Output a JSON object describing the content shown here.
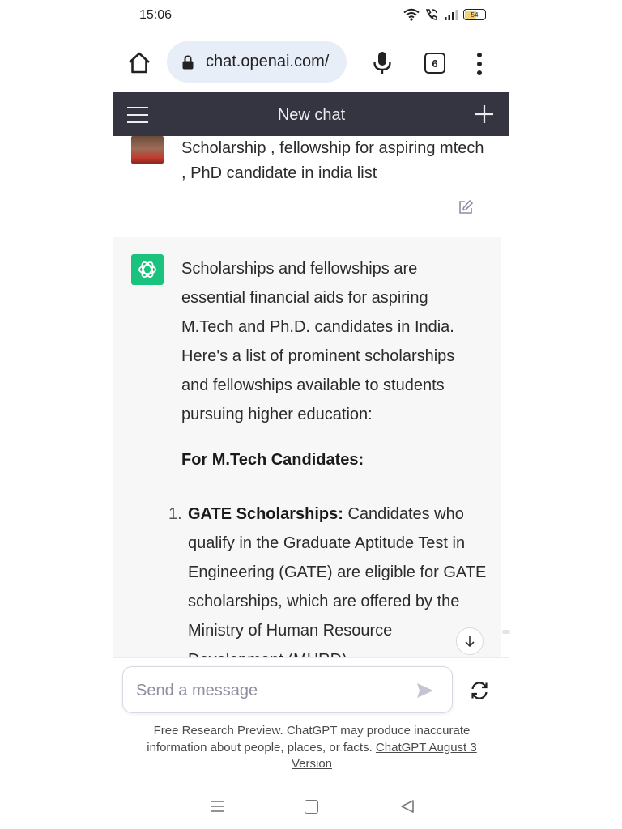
{
  "status_bar": {
    "time": "15:06",
    "battery": "54"
  },
  "browser": {
    "url": "chat.openai.com/",
    "tab_count": "6"
  },
  "header": {
    "title": "New chat"
  },
  "user_message": {
    "text": "Scholarship , fellowship for aspiring mtech , PhD candidate in india list"
  },
  "assistant_message": {
    "intro": "Scholarships and fellowships are essential financial aids for aspiring M.Tech and Ph.D. candidates in India. Here's a list of prominent scholarships and fellowships available to students pursuing higher education:",
    "heading": "For M.Tech Candidates:",
    "list": [
      {
        "number": "1.",
        "title": "GATE Scholarships:",
        "body": " Candidates who qualify in the Graduate Aptitude Test in Engineering (GATE) are eligible for GATE scholarships, which are offered by the Ministry of Human Resource Development (MHRD)."
      }
    ]
  },
  "composer": {
    "placeholder": "Send a message"
  },
  "disclaimer": {
    "text": "Free Research Preview. ChatGPT may produce inaccurate information about people, places, or facts. ",
    "link": "ChatGPT August 3 Version"
  },
  "colors": {
    "header_bg": "#343541",
    "assistant_avatar": "#19c37d",
    "assistant_bg": "#f7f7f8",
    "url_pill": "#e8eef8"
  },
  "icons": {
    "status": [
      "wifi-icon",
      "call-icon",
      "signal-icon",
      "battery-icon"
    ],
    "browser": [
      "home-icon",
      "lock-icon",
      "mic-icon",
      "tabs-icon",
      "more-vert-icon"
    ],
    "header": [
      "hamburger-icon",
      "plus-icon"
    ],
    "chat": [
      "edit-icon",
      "openai-logo-icon",
      "arrow-down-icon"
    ],
    "composer": [
      "send-icon",
      "regenerate-icon"
    ],
    "nav": [
      "nav-menu-icon",
      "nav-home-icon",
      "nav-back-icon"
    ]
  }
}
